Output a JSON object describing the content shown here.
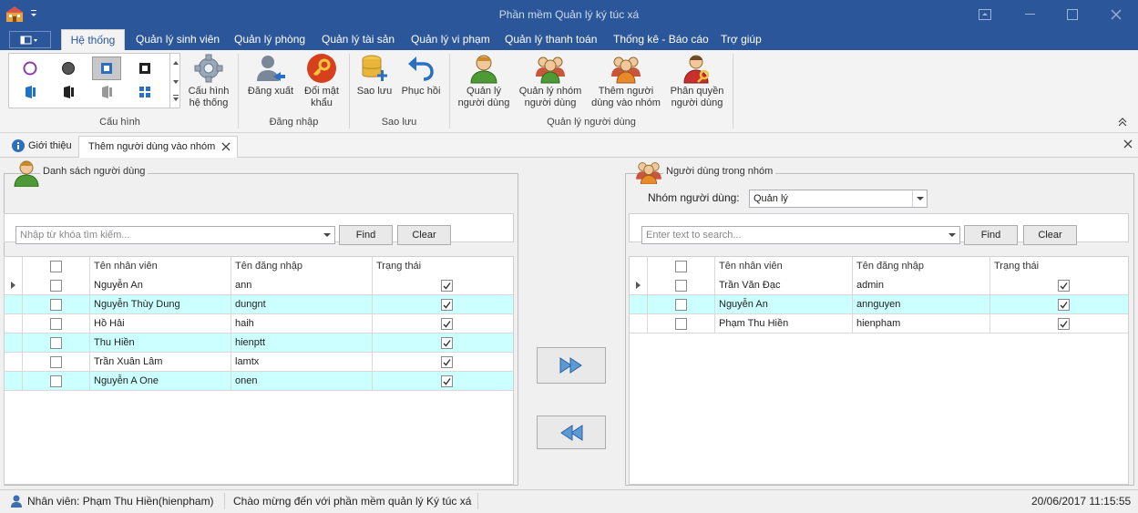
{
  "window": {
    "title": "Phần mềm Quản lý ký túc xá"
  },
  "ribbon_tabs": [
    "Hệ thống",
    "Quản lý sinh viên",
    "Quản lý phòng",
    "Quản lý tài sản",
    "Quản lý vi phạm",
    "Quản lý thanh toán",
    "Thống kê - Báo cáo",
    "Trợ giúp"
  ],
  "ribbon": {
    "cau_hinh": {
      "button": "Cấu hình\nhệ thống",
      "group": "Cấu hình"
    },
    "dang_nhap": {
      "logout": "Đăng xuất",
      "change_pw": "Đổi mật\nkhẩu",
      "group": "Đăng nhập"
    },
    "sao_luu": {
      "backup": "Sao lưu",
      "restore": "Phục hồi",
      "group": "Sao lưu"
    },
    "nguoi_dung": {
      "manage_users": "Quản lý\nngười dùng",
      "manage_groups": "Quản lý nhóm\nngười dùng",
      "add_to_group": "Thêm người\ndùng vào nhóm",
      "permissions": "Phân quyền\nngười dùng",
      "group": "Quản lý người dùng"
    }
  },
  "doc_tabs": {
    "intro": "Giới thiệu",
    "add_users": "Thêm người dùng vào nhóm"
  },
  "left": {
    "legend": "Danh sách người dùng",
    "search_placeholder": "Nhập từ khóa tìm kiếm...",
    "find": "Find",
    "clear": "Clear",
    "columns": [
      "Tên nhân viên",
      "Tên đăng nhập",
      "Trạng thái"
    ],
    "rows": [
      {
        "name": "Nguyễn An",
        "login": "ann",
        "status": true
      },
      {
        "name": "Nguyễn Thùy Dung",
        "login": "dungnt",
        "status": true
      },
      {
        "name": "Hồ Hải",
        "login": "haih",
        "status": true
      },
      {
        "name": "Thu Hiền",
        "login": "hienptt",
        "status": true
      },
      {
        "name": "Trần Xuân Lâm",
        "login": "lamtx",
        "status": true
      },
      {
        "name": "Nguyễn A One",
        "login": "onen",
        "status": true
      }
    ]
  },
  "right": {
    "legend": "Người dùng trong nhóm",
    "group_label": "Nhóm người dùng:",
    "group_value": "Quản lý",
    "search_placeholder": "Enter text to search...",
    "find": "Find",
    "clear": "Clear",
    "columns": [
      "Tên nhân viên",
      "Tên đăng nhập",
      "Trạng thái"
    ],
    "rows": [
      {
        "name": "Trần Văn Đạc",
        "login": "admin",
        "status": true
      },
      {
        "name": "Nguyễn An",
        "login": "annguyen",
        "status": true
      },
      {
        "name": "Phạm Thu Hiền",
        "login": "hienpham",
        "status": true
      }
    ]
  },
  "status": {
    "user": "Nhân viên: Phạm Thu Hiền(hienpham)",
    "welcome": "Chào mừng đến với phần mềm quản lý Ký túc xá",
    "datetime": "20/06/2017 11:15:55"
  },
  "colors": {
    "accent": "#2b579a",
    "row_alt": "#ccffff"
  }
}
